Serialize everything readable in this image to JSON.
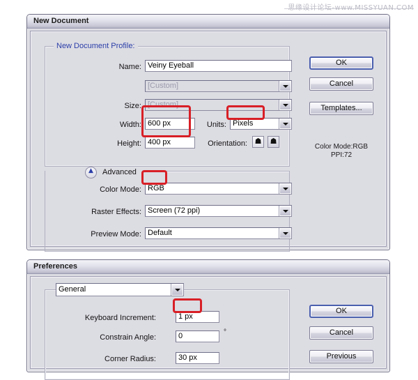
{
  "watermark": {
    "chinese": "思缘设计论坛",
    "site": "-www.MISSYUAN.COM"
  },
  "new_document_dialog": {
    "title": "New Document",
    "group_label": "New Document Profile:",
    "fields": {
      "name_label": "Name:",
      "name_value": "Veiny Eyeball",
      "profile_value": "[Custom]",
      "size_label": "Size:",
      "size_value": "[Custom]",
      "width_label": "Width:",
      "width_value": "600 px",
      "units_label": "Units:",
      "units_value": "Pixels",
      "height_label": "Height:",
      "height_value": "400 px",
      "orientation_label": "Orientation:",
      "orientation_portrait_icon": "portrait-icon",
      "orientation_landscape_icon": "landscape-icon"
    },
    "advanced": {
      "toggle_icon": "double-chevron-up-icon",
      "label": "Advanced",
      "color_mode_label": "Color Mode:",
      "color_mode_value": "RGB",
      "raster_effects_label": "Raster Effects:",
      "raster_effects_value": "Screen (72 ppi)",
      "preview_mode_label": "Preview Mode:",
      "preview_mode_value": "Default"
    },
    "buttons": {
      "ok": "OK",
      "cancel": "Cancel",
      "templates": "Templates..."
    },
    "summary": {
      "color_mode": "Color Mode:RGB",
      "ppi": "PPI:72"
    }
  },
  "preferences_dialog": {
    "title": "Preferences",
    "category_value": "General",
    "fields": {
      "keyboard_increment_label": "Keyboard Increment:",
      "keyboard_increment_value": "1 px",
      "constrain_angle_label": "Constrain Angle:",
      "constrain_angle_value": "0",
      "degree_symbol": "°",
      "corner_radius_label": "Corner Radius:",
      "corner_radius_value": "30 px"
    },
    "buttons": {
      "ok": "OK",
      "cancel": "Cancel",
      "previous": "Previous"
    }
  },
  "colors": {
    "highlight": "#d81f26",
    "dialog_face": "#dcdce3",
    "link_label": "#2b3ea8"
  }
}
